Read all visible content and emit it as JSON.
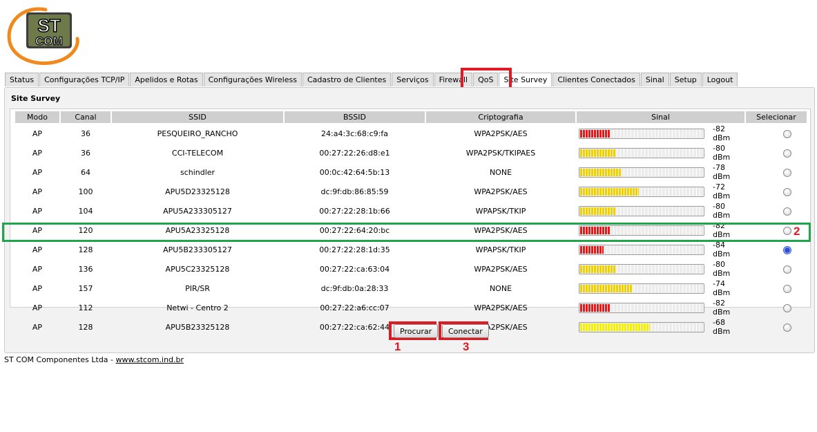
{
  "logo": {
    "line1": "ST",
    "line2": "COM"
  },
  "tabs": [
    {
      "label": "Status"
    },
    {
      "label": "Configurações TCP/IP"
    },
    {
      "label": "Apelidos e Rotas"
    },
    {
      "label": "Configurações Wireless"
    },
    {
      "label": "Cadastro de Clientes"
    },
    {
      "label": "Serviços"
    },
    {
      "label": "Firewall"
    },
    {
      "label": "QoS"
    },
    {
      "label": "Site Survey",
      "active": true
    },
    {
      "label": "Clientes Conectados"
    },
    {
      "label": "Sinal"
    },
    {
      "label": "Setup"
    },
    {
      "label": "Logout"
    }
  ],
  "panel": {
    "title": "Site Survey"
  },
  "table": {
    "headers": [
      "Modo",
      "Canal",
      "SSID",
      "BSSID",
      "Criptografia",
      "Sinal",
      "Selecionar"
    ],
    "rows": [
      {
        "modo": "AP",
        "canal": "36",
        "ssid": "PESQUEIRO_RANCHO",
        "bssid": "24:a4:3c:68:c9:fa",
        "cripto": "WPA2PSK/AES",
        "signal": "-82 dBm",
        "level": 0.24,
        "color": "red",
        "selected": false
      },
      {
        "modo": "AP",
        "canal": "36",
        "ssid": "CCI-TELECOM",
        "bssid": "00:27:22:26:d8:e1",
        "cripto": "WPA2PSK/TKIPAES",
        "signal": "-80 dBm",
        "level": 0.28,
        "color": "yellow",
        "selected": false
      },
      {
        "modo": "AP",
        "canal": "64",
        "ssid": "schindler",
        "bssid": "00:0c:42:64:5b:13",
        "cripto": "NONE",
        "signal": "-78 dBm",
        "level": 0.33,
        "color": "yellow",
        "selected": false
      },
      {
        "modo": "AP",
        "canal": "100",
        "ssid": "APU5D23325128",
        "bssid": "dc:9f:db:86:85:59",
        "cripto": "WPA2PSK/AES",
        "signal": "-72 dBm",
        "level": 0.47,
        "color": "yellow",
        "selected": false
      },
      {
        "modo": "AP",
        "canal": "104",
        "ssid": "APU5A233305127",
        "bssid": "00:27:22:28:1b:66",
        "cripto": "WPAPSK/TKIP",
        "signal": "-80 dBm",
        "level": 0.28,
        "color": "yellow",
        "selected": false
      },
      {
        "modo": "AP",
        "canal": "120",
        "ssid": "APU5A23325128",
        "bssid": "00:27:22:64:20:bc",
        "cripto": "WPA2PSK/AES",
        "signal": "-82 dBm",
        "level": 0.24,
        "color": "red",
        "selected": false
      },
      {
        "modo": "AP",
        "canal": "128",
        "ssid": "APU5B233305127",
        "bssid": "00:27:22:28:1d:35",
        "cripto": "WPAPSK/TKIP",
        "signal": "-84 dBm",
        "level": 0.19,
        "color": "red",
        "selected": true
      },
      {
        "modo": "AP",
        "canal": "136",
        "ssid": "APU5C23325128",
        "bssid": "00:27:22:ca:63:04",
        "cripto": "WPA2PSK/AES",
        "signal": "-80 dBm",
        "level": 0.28,
        "color": "yellow",
        "selected": false
      },
      {
        "modo": "AP",
        "canal": "157",
        "ssid": "PIR/SR",
        "bssid": "dc:9f:db:0a:28:33",
        "cripto": "NONE",
        "signal": "-74 dBm",
        "level": 0.42,
        "color": "yellow",
        "selected": false
      },
      {
        "modo": "AP",
        "canal": "112",
        "ssid": "Netwi - Centro 2",
        "bssid": "00:27:22:a6:cc:07",
        "cripto": "WPA2PSK/AES",
        "signal": "-82 dBm",
        "level": 0.24,
        "color": "red",
        "selected": false
      },
      {
        "modo": "AP",
        "canal": "128",
        "ssid": "APU5B23325128",
        "bssid": "00:27:22:ca:62:44",
        "cripto": "WPA2PSK/AES",
        "signal": "-68 dBm",
        "level": 0.56,
        "color": "bright",
        "selected": false
      }
    ]
  },
  "buttons": {
    "procurar": "Procurar",
    "conectar": "Conectar"
  },
  "annotations": {
    "one": "1",
    "two": "2",
    "three": "3"
  },
  "colors": {
    "highlight_red": "#e01a22",
    "highlight_green": "#1fa64a"
  },
  "footer": {
    "company": "ST COM Componentes Ltda - ",
    "link": "www.stcom.ind.br"
  }
}
